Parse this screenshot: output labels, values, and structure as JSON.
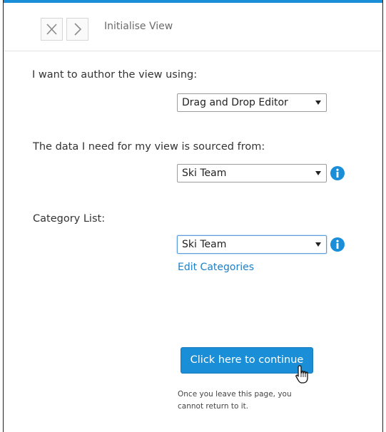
{
  "header": {
    "title": "Initialise View",
    "close_icon": "close-icon",
    "next_icon": "chevron-right-icon"
  },
  "form": {
    "author_label": "I want to author the view using:",
    "author_value": "Drag and Drop Editor",
    "source_label": "The data I need for my view is sourced from:",
    "source_value": "Ski Team",
    "category_label": "Category List:",
    "category_value": "Ski Team",
    "edit_categories_link": "Edit Categories"
  },
  "actions": {
    "continue_label": "Click here to continue",
    "note_line1": "Once you leave this page, you",
    "note_line2": "cannot return to it."
  },
  "colors": {
    "accent": "#1a8fd8",
    "link": "#1d7fc8",
    "info_icon": "#1a8fd8"
  }
}
